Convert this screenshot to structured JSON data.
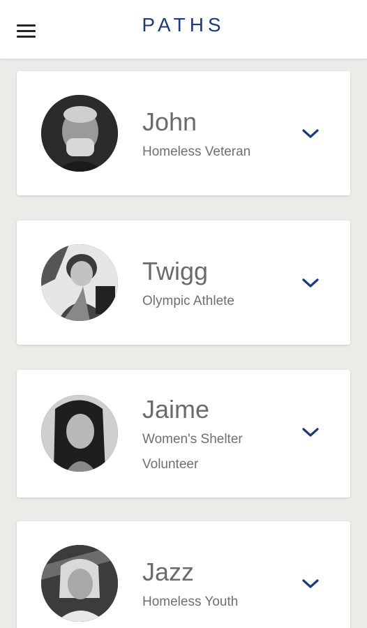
{
  "header": {
    "brand": "PATHS",
    "menu_icon": "hamburger-menu-icon",
    "brand_color": "#1f3a7a"
  },
  "profiles": [
    {
      "name": "John",
      "role": "Homeless Veteran",
      "avatar": "portrait-photo-john"
    },
    {
      "name": "Twigg",
      "role": "Olympic Athlete",
      "avatar": "portrait-photo-twigg"
    },
    {
      "name": "Jaime",
      "role": "Women's Shelter Volunteer",
      "avatar": "portrait-photo-jaime"
    },
    {
      "name": "Jazz",
      "role": "Homeless Youth",
      "avatar": "portrait-photo-jazz"
    }
  ],
  "chevron_icon": "chevron-down-icon",
  "colors": {
    "accent": "#1f3a7a",
    "background": "#ecebe8",
    "card": "#ffffff",
    "text": "#6b6b6b"
  }
}
